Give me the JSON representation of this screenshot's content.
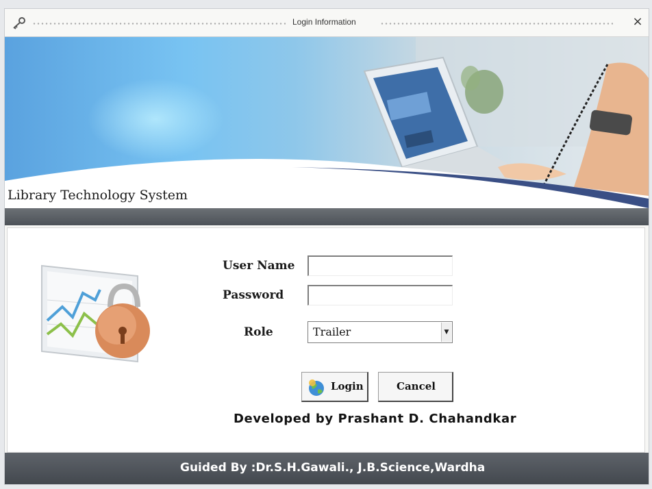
{
  "window": {
    "title": "Login Information",
    "close_label": "×"
  },
  "banner": {
    "app_title": "Library Technology System"
  },
  "form": {
    "username_label": "User Name",
    "username_value": "",
    "password_label": "Password",
    "password_value": "",
    "role_label": "Role",
    "role_selected": "Trailer",
    "login_label": "Login",
    "cancel_label": "Cancel"
  },
  "developer_credit": "Developed by Prashant D. Chahandkar",
  "footer": {
    "guided_by": "Guided By :Dr.S.H.Gawali., J.B.Science,Wardha"
  },
  "icons": {
    "app": "key-icon",
    "login": "globe-icon",
    "role_dropdown": "chevron-down-icon",
    "art": "lock-chart-icon"
  },
  "colors": {
    "banner_blue": "#78c3f2",
    "strip_dark": "#4d5258",
    "window_bg": "#f7f7f5"
  }
}
